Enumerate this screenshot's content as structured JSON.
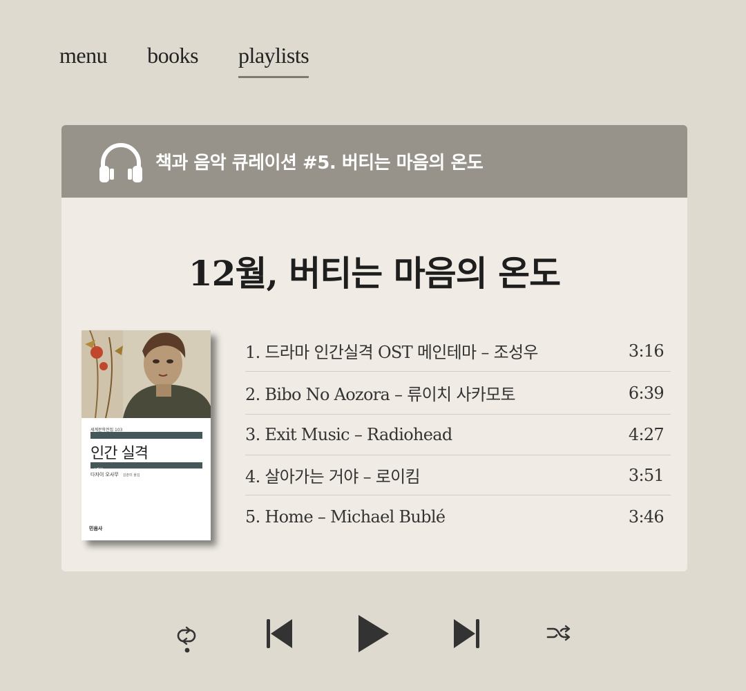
{
  "nav": {
    "items": [
      {
        "label": "menu"
      },
      {
        "label": "books"
      },
      {
        "label": "playlists"
      }
    ],
    "active": "playlists"
  },
  "card": {
    "header_icon": "headphones-icon",
    "header_title": "책과 음악 큐레이션 #5. 버티는 마음의 온도",
    "playlist_title": "12월, 버티는 마음의 온도"
  },
  "book": {
    "series": "세계문학전집 103",
    "title": "인간 실격",
    "label": "스페셜",
    "author": "다자이 오사무",
    "translator": "김춘미 옮김",
    "publisher": "민음사"
  },
  "tracks": [
    {
      "label": "1. 드라마 인간실격 OST 메인테마 – 조성우",
      "duration": "3:16"
    },
    {
      "label": "2. Bibo No Aozora – 류이치 사카모토",
      "duration": "6:39"
    },
    {
      "label": "3. Exit Music – Radiohead",
      "duration": "4:27"
    },
    {
      "label": "4. 살아가는 거야  – 로이킴",
      "duration": "3:51"
    },
    {
      "label": "5. Home – Michael Bublé",
      "duration": "3:46"
    }
  ],
  "controls": {
    "icons": [
      "repeat-icon",
      "skip-previous-icon",
      "play-icon",
      "skip-next-icon",
      "shuffle-icon"
    ],
    "color": "#333333"
  },
  "colors": {
    "background": "#dedacf",
    "card": "#f0ece5",
    "header": "#97938a",
    "book_accent": "#44585a"
  }
}
